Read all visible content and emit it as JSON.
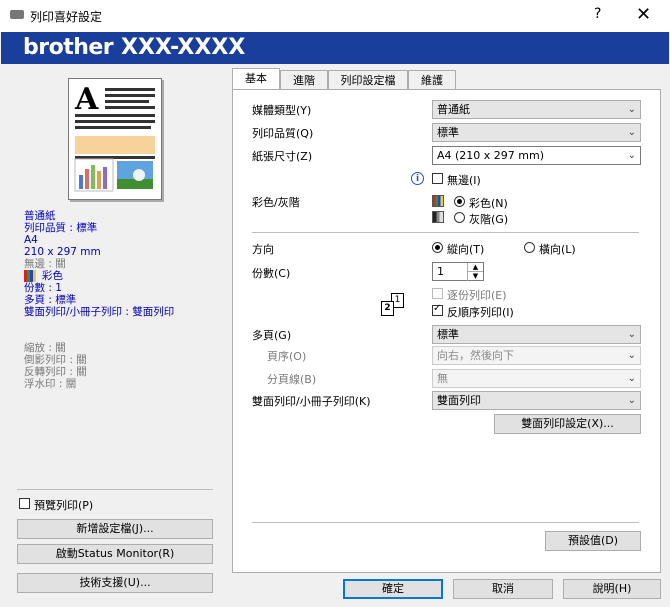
{
  "window": {
    "title": "列印喜好設定",
    "help": "?",
    "close": "✕"
  },
  "banner": {
    "brand": "brother",
    "model": "XXX-XXXX"
  },
  "summary": {
    "lines_blue": [
      "普通紙",
      "列印品質 : 標準",
      "A4",
      "210 x 297 mm"
    ],
    "borderless": "無邊 : 關",
    "color": "彩色",
    "lines_blue2": [
      "份數 : 1",
      "多頁 : 標準",
      "雙面列印/小冊子列印 : 雙面列印"
    ],
    "lines_gray": [
      "縮放 : 關",
      "倒影列印 : 關",
      "反轉列印 : 關",
      "浮水印 : 關"
    ]
  },
  "left_buttons": {
    "preview_label": "預覽列印(P)",
    "add_profile": "新增設定檔(J)...",
    "status_monitor": "啟動Status Monitor(R)",
    "support": "技術支援(U)..."
  },
  "tabs": [
    "基本",
    "進階",
    "列印設定檔",
    "維護"
  ],
  "basic": {
    "media_type_label": "媒體類型(Y)",
    "media_type_value": "普通紙",
    "quality_label": "列印品質(Q)",
    "quality_value": "標準",
    "paper_size_label": "紙張尺寸(Z)",
    "paper_size_value": "A4 (210 x 297 mm)",
    "borderless_label": "無邊(I)",
    "color_label": "彩色/灰階",
    "color_opt": "彩色(N)",
    "gray_opt": "灰階(G)",
    "orientation_label": "方向",
    "portrait": "縱向(T)",
    "landscape": "橫向(L)",
    "copies_label": "份數(C)",
    "copies_value": "1",
    "collate_label": "逐份列印(E)",
    "reverse_label": "反順序列印(I)",
    "multipage_label": "多頁(G)",
    "multipage_value": "標準",
    "page_order_label": "頁序(O)",
    "page_order_value": "向右，然後向下",
    "border_line_label": "分頁線(B)",
    "border_line_value": "無",
    "duplex_label": "雙面列印/小冊子列印(K)",
    "duplex_value": "雙面列印",
    "duplex_settings": "雙面列印設定(X)...",
    "default_btn": "預設值(D)"
  },
  "footer": {
    "ok": "確定",
    "cancel": "取消",
    "help": "說明(H)"
  }
}
